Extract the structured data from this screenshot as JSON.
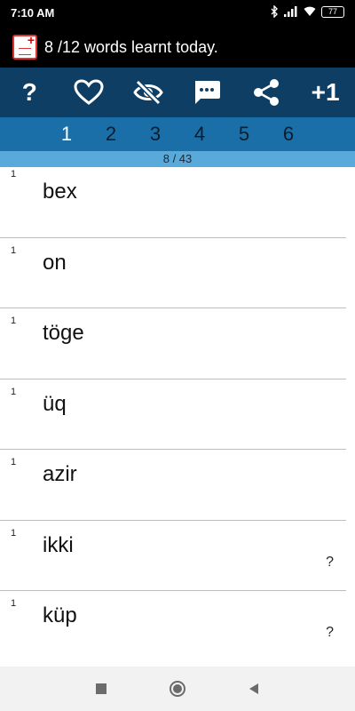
{
  "status": {
    "time": "7:10 AM",
    "battery": "77"
  },
  "header": {
    "title": "8 /12 words learnt today."
  },
  "toolbar": {
    "help_label": "?",
    "plus_label": "+1"
  },
  "tabs": [
    "1",
    "2",
    "3",
    "4",
    "5",
    "6"
  ],
  "progress": {
    "text": "8 / 43"
  },
  "words": [
    {
      "count": "1",
      "word": "bex",
      "mark": ""
    },
    {
      "count": "1",
      "word": "on",
      "mark": ""
    },
    {
      "count": "1",
      "word": "töge",
      "mark": ""
    },
    {
      "count": "1",
      "word": "üq",
      "mark": ""
    },
    {
      "count": "1",
      "word": "azir",
      "mark": ""
    },
    {
      "count": "1",
      "word": "ikki",
      "mark": "?"
    },
    {
      "count": "1",
      "word": "küp",
      "mark": "?"
    }
  ],
  "colors": {
    "toolbar": "#0e3e63",
    "tabs": "#1b6fa9",
    "progress": "#5aa9db"
  }
}
